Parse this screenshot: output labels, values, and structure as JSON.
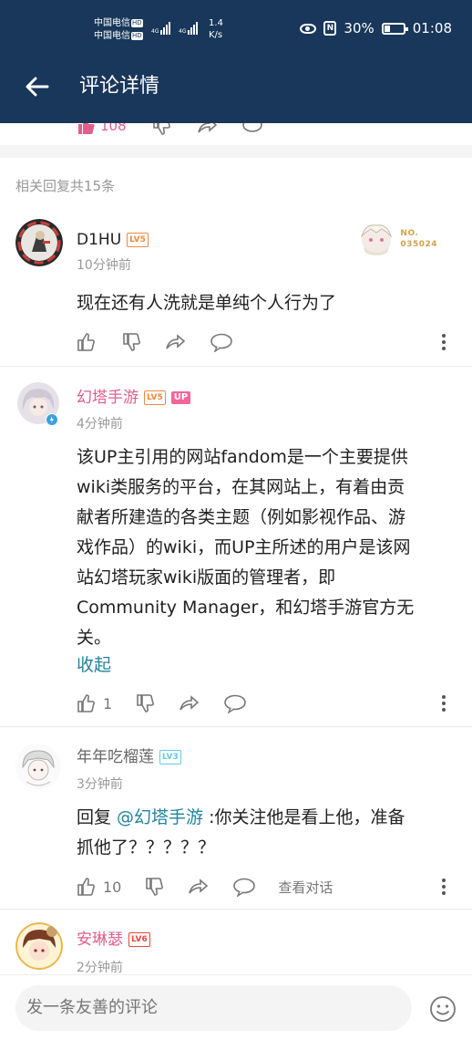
{
  "status_bar": {
    "carrier1": "中国电信",
    "carrier2": "中国电信",
    "hd": "HD",
    "net_type": "4G",
    "net_speed_value": "1.4",
    "net_speed_unit": "K/s",
    "nfc": "N",
    "battery": "30%",
    "battery_level": 0.3,
    "time": "01:08"
  },
  "header": {
    "title": "评论详情"
  },
  "prev_comment": {
    "like_count": "108"
  },
  "reply_count_text": "相关回复共15条",
  "comments": [
    {
      "username": "D1HU",
      "level": "LV5",
      "time": "10分钟前",
      "text": "现在还有人洗就是单纯个人行为了",
      "badge_no": "NO.",
      "badge_num": "035024"
    },
    {
      "username": "幻塔手游",
      "level": "LV5",
      "up_tag": "UP",
      "time": "4分钟前",
      "text_lines": [
        "该UP主引用的网站fandom是一个主要提供",
        "wiki类服务的平台，在其网站上，有着由贡",
        "献者所建造的各类主题（例如影视作品、游",
        "戏作品）的wiki，而UP主所述的用户是该网",
        "站幻塔玩家wiki版面的管理者，即",
        "Community Manager，和幻塔手游官方无",
        "关。"
      ],
      "collapse": "收起",
      "like_count": "1"
    },
    {
      "username": "年年吃榴莲",
      "level": "LV3",
      "time": "3分钟前",
      "reply_prefix": "回复 ",
      "mention": "@幻塔手游",
      "text_line1": " :你关注他是看上他，准备",
      "text_line2": "抓他了？？？？？",
      "like_count": "10",
      "view_dialog": "查看对话"
    },
    {
      "username": "安琳瑟",
      "level": "LV6",
      "time": "2分钟前"
    }
  ],
  "input": {
    "placeholder": "发一条友善的评论"
  },
  "colors": {
    "header_bg": "#18375a",
    "up_name": "#e25e8a",
    "link": "#22839c",
    "lv5": "#f08a3e",
    "lv3": "#68c8e8",
    "lv6": "#e8473a"
  }
}
